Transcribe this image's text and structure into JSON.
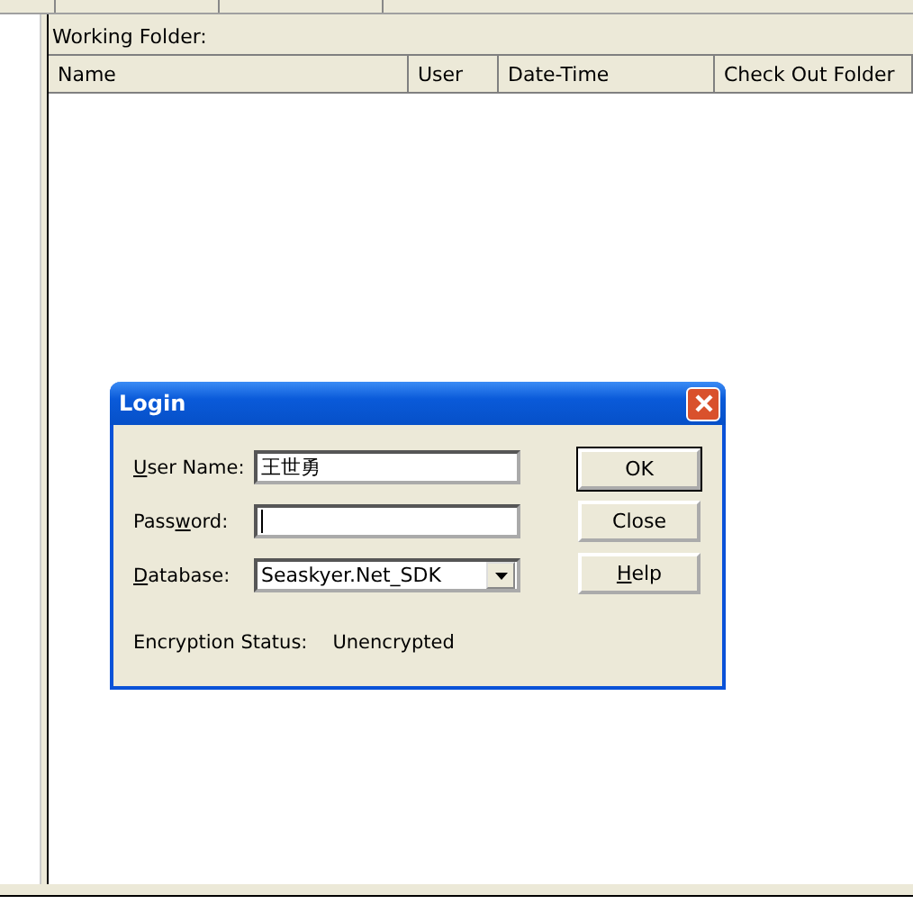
{
  "working_folder": {
    "label": "Working Folder:"
  },
  "table": {
    "columns": [
      {
        "label": "Name"
      },
      {
        "label": "User"
      },
      {
        "label": "Date-Time"
      },
      {
        "label": "Check Out Folder"
      }
    ]
  },
  "dialog": {
    "title": "Login",
    "fields": [
      {
        "kind": "text",
        "label": {
          "key": "U",
          "after": "ser Name:"
        },
        "value": "王世勇"
      },
      {
        "kind": "password",
        "label": {
          "before": "Pass",
          "key": "w",
          "after": "ord:"
        }
      },
      {
        "kind": "select",
        "label": {
          "key": "D",
          "after": "atabase:"
        },
        "value": "Seaskyer.Net_SDK"
      }
    ],
    "buttons": [
      {
        "label": {
          "after": "OK"
        },
        "default": true
      },
      {
        "label": {
          "after": "Close"
        },
        "default": false
      },
      {
        "label": {
          "key": "H",
          "after": "elp"
        },
        "default": false
      }
    ],
    "status": {
      "label": "Encryption Status:",
      "value": "Unencrypted"
    }
  }
}
